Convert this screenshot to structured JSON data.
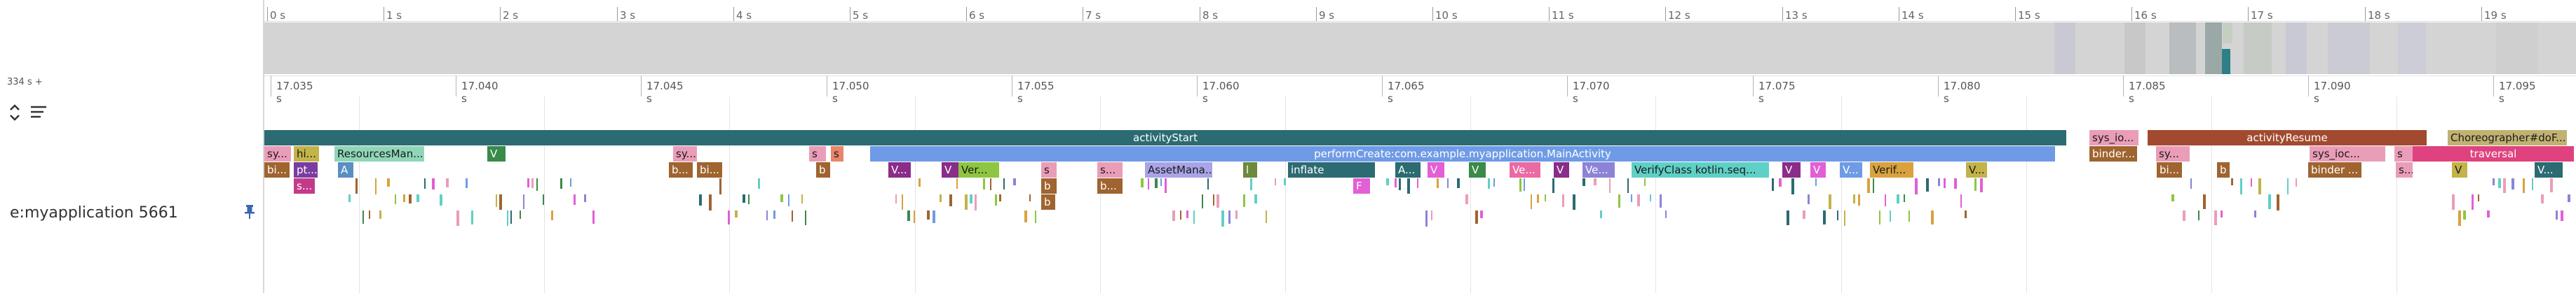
{
  "overview": {
    "ticks": [
      "0 s",
      "1 s",
      "2 s",
      "3 s",
      "4 s",
      "5 s",
      "6 s",
      "7 s",
      "8 s",
      "9 s",
      "10 s",
      "11 s",
      "12 s",
      "13 s",
      "14 s",
      "15 s",
      "16 s",
      "17 s",
      "18 s",
      "19 s"
    ]
  },
  "scale_label": "334 s +",
  "detail": {
    "ticks": [
      "17.035 s",
      "17.040 s",
      "17.045 s",
      "17.050 s",
      "17.055 s",
      "17.060 s",
      "17.065 s",
      "17.070 s",
      "17.075 s",
      "17.080 s",
      "17.085 s",
      "17.090 s",
      "17.095 s"
    ]
  },
  "process": {
    "label": "e:myapplication 5661"
  },
  "slices": {
    "activityStart": "activityStart",
    "sys_io": "sys_io...",
    "activityResume": "activityResume",
    "choreographer": "Choreographer#doF...",
    "sy1": "sy...",
    "hi": "hi...",
    "resourcesMan": "ResourcesMan...",
    "v1": "V",
    "sy2": "sy...",
    "s1": "s",
    "s2": "s",
    "performCreate": "performCreate:com.example.myapplication.MainActivity",
    "binder1": "binder...",
    "sy3": "sy...",
    "sys_ioc": "sys_ioc...",
    "s3": "s",
    "traversal": "traversal",
    "bi1": "bi...",
    "pt": "pt...",
    "a1": "A",
    "b1": "b...",
    "bi2": "bi...",
    "b2": "b",
    "v2": "V...",
    "v3": "V",
    "ver": "Ver...",
    "s4": "s",
    "s5": "s...",
    "assetMana": "AssetMana...",
    "l1": "l",
    "inflate": "inflate",
    "a2": "A...",
    "v4": "V",
    "v5": "V",
    "ve1": "Ve...",
    "v6": "V",
    "ve2": "Ve...",
    "verifyClass": "VerifyClass kotlin.seq...",
    "v7": "V",
    "v8": "V",
    "v9": "V...",
    "verif": "Verif...",
    "v10": "V...",
    "bi3": "bi...",
    "b3": "b",
    "binder2": "binder ...",
    "v11": "V",
    "v12": "V...",
    "s6": "s...",
    "b4": "b",
    "b5": "b...",
    "f1": "F",
    "b6": "b"
  },
  "colors": {
    "activityStart": "#2c6b72",
    "activityResume": "#a24a2f",
    "performCreate": "#6f9be6",
    "traversal": "#e0427f",
    "overviewBand": "#d4d4d4"
  }
}
